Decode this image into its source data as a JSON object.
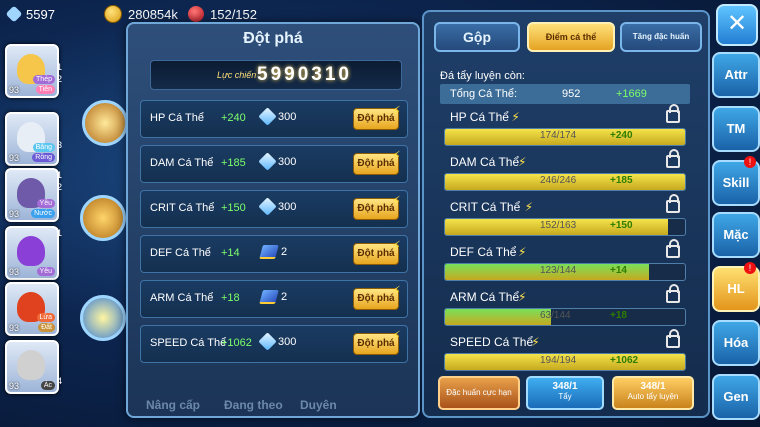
{
  "resources": {
    "gems": "5597",
    "gold": "280854k",
    "stamina": "152/152"
  },
  "characters": [
    {
      "level": "93",
      "tags": [
        "Thép",
        "Tiên"
      ],
      "tag_colors": [
        "#a26bd6",
        "#ff7eb3"
      ],
      "color": "#f5c64a"
    },
    {
      "level": "93",
      "tags": [
        "Băng",
        "Rồng"
      ],
      "tag_colors": [
        "#5cc6f0",
        "#6b5ad6"
      ],
      "color": "#e8eef6"
    },
    {
      "level": "93",
      "tags": [
        "Yêu",
        "Nước"
      ],
      "tag_colors": [
        "#a26bd6",
        "#3aa0f0"
      ],
      "color": "#6e5aa8"
    },
    {
      "level": "93",
      "tags": [
        "Yêu"
      ],
      "tag_colors": [
        "#a26bd6"
      ],
      "color": "#8a3fd6"
    },
    {
      "level": "93",
      "tags": [
        "Lửa",
        "Đất"
      ],
      "tag_colors": [
        "#f06a3a",
        "#c9923a"
      ],
      "color": "#e0421f"
    },
    {
      "level": "93",
      "tags": [
        "Ác"
      ],
      "tag_colors": [
        "#444"
      ],
      "color": "#d0d0d0"
    }
  ],
  "side_numbers": [
    "1",
    "2",
    "3",
    "1",
    "2",
    "1",
    "4"
  ],
  "popup": {
    "title": "Đột phá",
    "power_label": "Lực chiến",
    "power_value": "5990310",
    "break_label": "Đột phá",
    "rows": [
      {
        "name": "HP Cá Thể",
        "plus": "+240",
        "cost": "300",
        "cost_type": "diamond"
      },
      {
        "name": "DAM Cá Thể",
        "plus": "+185",
        "cost": "300",
        "cost_type": "diamond"
      },
      {
        "name": "CRIT Cá Thể",
        "plus": "+150",
        "cost": "300",
        "cost_type": "diamond"
      },
      {
        "name": "DEF Cá Thể",
        "plus": "+14",
        "cost": "2",
        "cost_type": "book"
      },
      {
        "name": "ARM Cá Thể",
        "plus": "+18",
        "cost": "2",
        "cost_type": "book"
      },
      {
        "name": "SPEED Cá Thể",
        "plus": "+1062",
        "cost": "300",
        "cost_type": "diamond"
      }
    ],
    "faded_buttons": [
      "Nâng cấp",
      "Đang theo",
      "Duyên"
    ]
  },
  "right_panel": {
    "tabs": [
      "Gộp",
      "Điểm cá thể",
      "Tăng đặc huấn"
    ],
    "remaining_label": "Đá tẩy luyện còn:",
    "total_label": "Tổng Cá Thể:",
    "total_value": "952",
    "total_plus": "+1669",
    "stats": [
      {
        "name": "HP Cá Thể",
        "value": "174/174",
        "plus": "+240",
        "fill": 1.0,
        "color": "#f3e34a"
      },
      {
        "name": "DAM Cá Thể",
        "value": "246/246",
        "plus": "+185",
        "fill": 1.0,
        "color": "#f3e34a"
      },
      {
        "name": "CRIT Cá Thể",
        "value": "152/163",
        "plus": "+150",
        "fill": 0.93,
        "color": "#f3e34a"
      },
      {
        "name": "DEF Cá Thể",
        "value": "123/144",
        "plus": "+14",
        "fill": 0.85,
        "color": "#79e05a"
      },
      {
        "name": "ARM Cá Thể",
        "value": "63/144",
        "plus": "+18",
        "fill": 0.44,
        "color": "#79e05a"
      },
      {
        "name": "SPEED Cá Thể",
        "value": "194/194",
        "plus": "+1062",
        "fill": 1.0,
        "color": "#f3e34a"
      }
    ],
    "bottom_buttons": [
      {
        "label": "Đặc huấn cực hạn"
      },
      {
        "count": "348/1",
        "label": "Tẩy"
      },
      {
        "count": "348/1",
        "label": "Auto tẩy luyện"
      }
    ]
  },
  "right_menu": [
    "Attr",
    "TM",
    "Skill",
    "Mặc",
    "HL",
    "Hóa",
    "Gen"
  ],
  "colors": {
    "accent_gold": "#e7a51f",
    "accent_blue": "#3fa7e6",
    "positive_green": "#7cff6a"
  }
}
